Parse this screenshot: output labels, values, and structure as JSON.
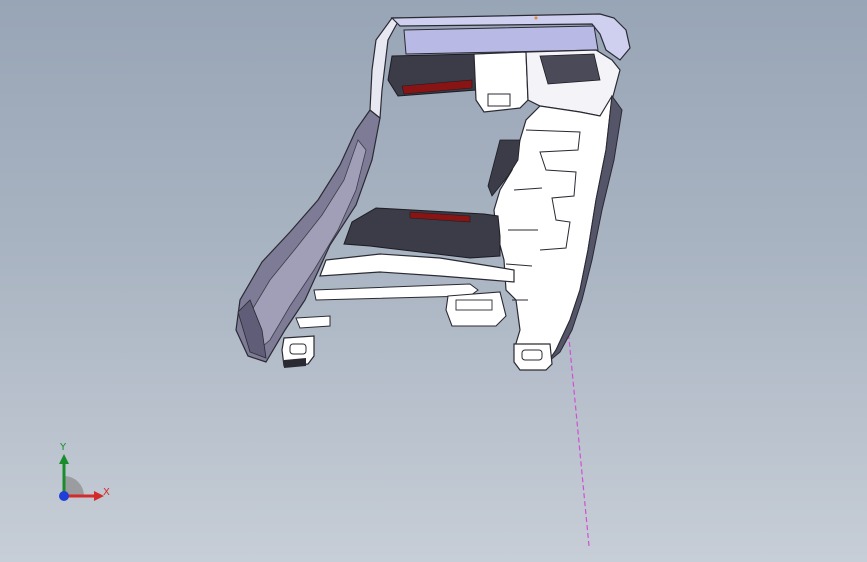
{
  "viewport": {
    "background_top": "#98a5b6",
    "background_bottom": "#c7ced7"
  },
  "model": {
    "shell_color": "#ffffff",
    "edge_color": "#2a2a33",
    "shade_color": "#3c3c48",
    "highlight_color": "#b9b9e6",
    "rib_accent_color": "#8a1414",
    "sketch_line_color": "#d24fd2"
  },
  "triad": {
    "x_label": "X",
    "y_label": "Y",
    "x_color": "#d42a2a",
    "y_color": "#1a8c2b",
    "z_color": "#1f3fd6",
    "x_icon": "x-axis-arrow-icon",
    "y_icon": "y-axis-arrow-icon",
    "origin_icon": "z-axis-dot-icon"
  }
}
